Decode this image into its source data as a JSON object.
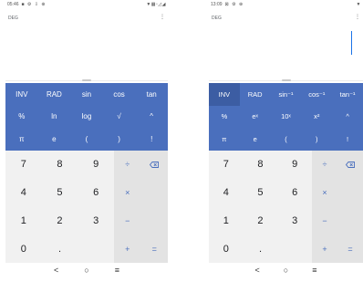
{
  "screen_a": {
    "status": {
      "time": "05:46",
      "left_icons": "■ ⚙ ⇩ ⊕",
      "right_icons": "▼▦▫◿◢"
    },
    "display": {
      "angle_mode": "DEG",
      "more_icon": "⋮"
    },
    "sci_keys": [
      "INV",
      "RAD",
      "sin",
      "cos",
      "tan",
      "%",
      "ln",
      "log",
      "√",
      "^",
      "π",
      "e",
      "(",
      ")",
      "!"
    ],
    "num_keys": [
      "7",
      "8",
      "9",
      "4",
      "5",
      "6",
      "1",
      "2",
      "3",
      "0",
      ".",
      ""
    ],
    "ops": [
      "÷",
      "",
      "×",
      "",
      "−",
      "",
      "+",
      "="
    ],
    "nav": [
      "<",
      "○",
      "≡"
    ]
  },
  "screen_b": {
    "status": {
      "time": "13:09",
      "left_icons": "⊠ ⚙ ⊕",
      "right_icons": "▼"
    },
    "display": {
      "angle_mode": "DEG",
      "more_icon": "⋮"
    },
    "sci_keys": [
      "INV",
      "RAD",
      "sin⁻¹",
      "cos⁻¹",
      "tan⁻¹",
      "%",
      "eˣ",
      "10ˣ",
      "x²",
      "^",
      "π",
      "e",
      "(",
      ")",
      "!"
    ],
    "num_keys": [
      "7",
      "8",
      "9",
      "4",
      "5",
      "6",
      "1",
      "2",
      "3",
      "0",
      ".",
      ""
    ],
    "ops": [
      "÷",
      "",
      "×",
      "",
      "−",
      "",
      "+",
      "="
    ],
    "nav": [
      "<",
      "○",
      "≡"
    ]
  },
  "colors": {
    "accent": "#4a6fbd",
    "accent_active": "#3c5da3",
    "keypad": "#f1f1f1",
    "ops": "#e3e3e3",
    "cursor": "#1a73e8"
  }
}
